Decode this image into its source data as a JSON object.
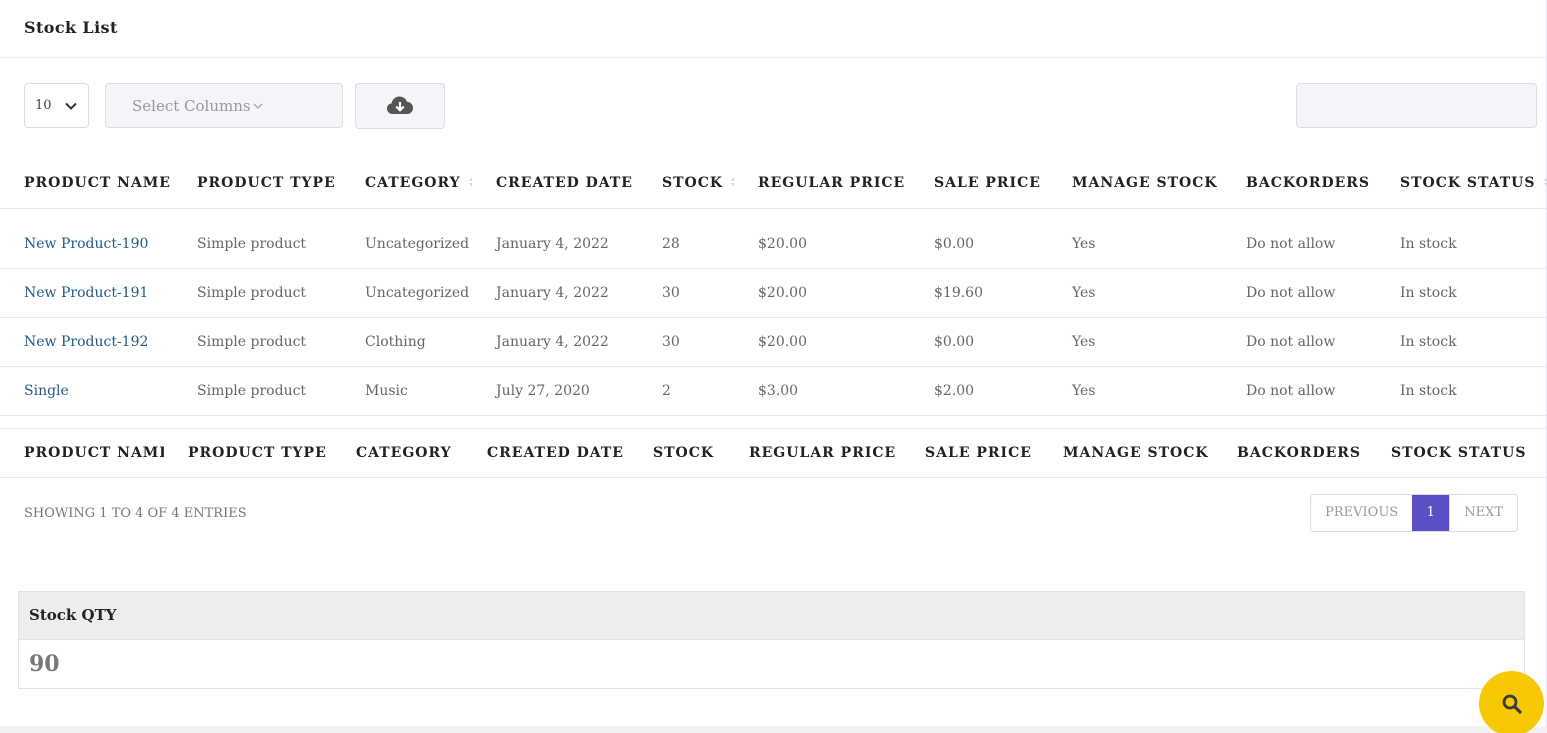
{
  "page": {
    "title": "Stock List"
  },
  "controls": {
    "page_length": "10",
    "select_columns_placeholder": "Select Columns",
    "search_value": ""
  },
  "table": {
    "columns": [
      "PRODUCT NAME",
      "PRODUCT TYPE",
      "CATEGORY",
      "CREATED DATE",
      "STOCK",
      "REGULAR PRICE",
      "SALE PRICE",
      "MANAGE STOCK",
      "BACKORDERS",
      "STOCK STATUS"
    ],
    "rows": [
      [
        "New Product-190",
        "Simple product",
        "Uncategorized",
        "January 4, 2022",
        "28",
        "$20.00",
        "$0.00",
        "Yes",
        "Do not allow",
        "In stock"
      ],
      [
        "New Product-191",
        "Simple product",
        "Uncategorized",
        "January 4, 2022",
        "30",
        "$20.00",
        "$19.60",
        "Yes",
        "Do not allow",
        "In stock"
      ],
      [
        "New Product-192",
        "Simple product",
        "Clothing",
        "January 4, 2022",
        "30",
        "$20.00",
        "$0.00",
        "Yes",
        "Do not allow",
        "In stock"
      ],
      [
        "Single",
        "Simple product",
        "Music",
        "July 27, 2020",
        "2",
        "$3.00",
        "$2.00",
        "Yes",
        "Do not allow",
        "In stock"
      ]
    ]
  },
  "footer": {
    "info": "SHOWING 1 TO 4 OF 4 ENTRIES",
    "previous": "PREVIOUS",
    "current_page": "1",
    "next": "NEXT"
  },
  "summary": {
    "label": "Stock QTY",
    "value": "90"
  },
  "colors": {
    "accent": "#5a4fc4",
    "link": "#1f5a8a",
    "fab": "#f9c805"
  },
  "icons": {
    "download": "cloud-download-icon",
    "search": "search-icon",
    "chevron": "chevron-down-icon"
  }
}
